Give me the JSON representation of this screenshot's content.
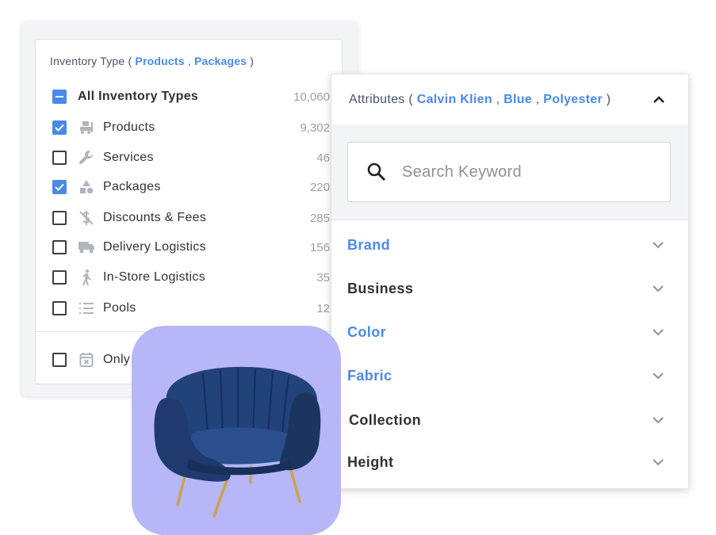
{
  "inventory": {
    "title_prefix": "Inventory Type (",
    "title_selected_1": "Products",
    "title_sep": ",",
    "title_selected_2": "Packages",
    "title_suffix": ")",
    "rows": [
      {
        "label": "All Inventory Types",
        "count": "10,060",
        "state": "indeterminate"
      },
      {
        "label": "Products",
        "count": "9,302",
        "state": "checked",
        "icon": "forklift-icon"
      },
      {
        "label": "Services",
        "count": "46",
        "state": "unchecked",
        "icon": "wrench-icon"
      },
      {
        "label": "Packages",
        "count": "220",
        "state": "checked",
        "icon": "shapes-icon"
      },
      {
        "label": "Discounts & Fees",
        "count": "285",
        "state": "unchecked",
        "icon": "no-dollar-icon"
      },
      {
        "label": "Delivery Logistics",
        "count": "156",
        "state": "unchecked",
        "icon": "truck-icon"
      },
      {
        "label": "In-Store Logistics",
        "count": "35",
        "state": "unchecked",
        "icon": "walking-person-icon"
      },
      {
        "label": "Pools",
        "count": "12",
        "state": "unchecked",
        "icon": "list-icon"
      }
    ],
    "only_label": "Only",
    "only_icon": "calendar-x-icon"
  },
  "attributes": {
    "title_prefix": "Attributes (",
    "selected": [
      "Calvin Klien",
      "Blue",
      "Polyester"
    ],
    "sep": ",",
    "title_suffix": ")",
    "search_placeholder": "Search Keyword",
    "items": [
      {
        "label": "Brand",
        "active": true
      },
      {
        "label": "Business",
        "active": false
      },
      {
        "label": "Color",
        "active": true
      },
      {
        "label": "Fabric",
        "active": true
      },
      {
        "label": "Collection",
        "active": false
      },
      {
        "label": "Height",
        "active": false
      }
    ]
  },
  "colors": {
    "accent": "#4a8ae6",
    "chair_bg": "#b7b6f8",
    "chair_fabric": "#1e3a6e",
    "chair_legs": "#c9a24b"
  }
}
